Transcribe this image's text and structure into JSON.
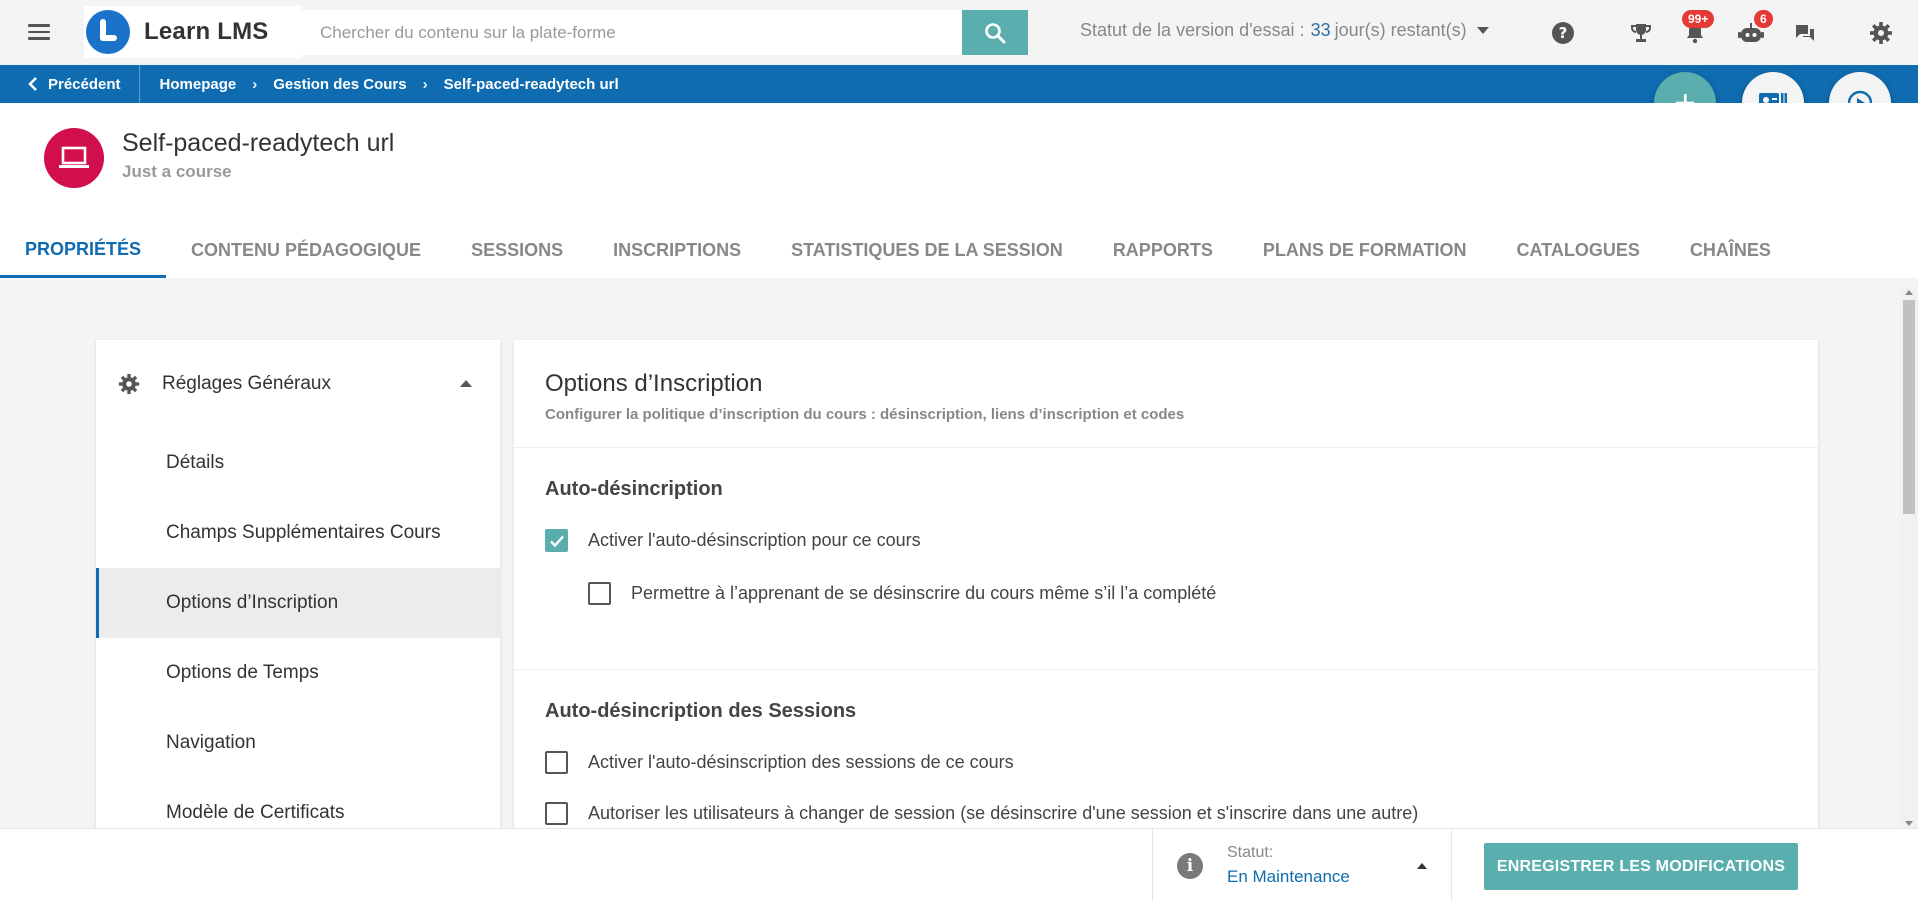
{
  "app": {
    "name": "Learn LMS"
  },
  "search": {
    "placeholder": "Chercher du contenu sur la plate-forme"
  },
  "trial": {
    "prefix": "Statut de la version d'essai :",
    "days": "33",
    "suffix": "jour(s) restant(s)"
  },
  "top_icons": {
    "help": "help-circle-icon",
    "trophy": "trophy-icon",
    "notifications_badge": "99+",
    "robot_badge": "6",
    "chat": "chat-icon",
    "settings": "gear-icon"
  },
  "breadcrumb": {
    "back_label": "Précédent",
    "items": [
      "Homepage",
      "Gestion des Cours",
      "Self-paced-readytech url"
    ]
  },
  "course": {
    "title": "Self-paced-readytech url",
    "subtitle": "Just a course",
    "icon_color": "#d10f4c"
  },
  "tabs": [
    {
      "label": "PROPRIÉTÉS",
      "active": true
    },
    {
      "label": "CONTENU PÉDAGOGIQUE"
    },
    {
      "label": "SESSIONS"
    },
    {
      "label": "INSCRIPTIONS"
    },
    {
      "label": "STATISTIQUES DE LA SESSION"
    },
    {
      "label": "RAPPORTS"
    },
    {
      "label": "PLANS DE FORMATION"
    },
    {
      "label": "CATALOGUES"
    },
    {
      "label": "CHAÎNES"
    }
  ],
  "sidebar": {
    "header": "Réglages Généraux",
    "items": [
      {
        "label": "Détails"
      },
      {
        "label": "Champs Supplémentaires Cours"
      },
      {
        "label": "Options d’Inscription",
        "active": true
      },
      {
        "label": "Options de Temps"
      },
      {
        "label": "Navigation"
      },
      {
        "label": "Modèle de Certificats"
      }
    ]
  },
  "main": {
    "title": "Options d’Inscription",
    "description": "Configurer la politique d’inscription du cours : désinscription, liens d’inscription et codes",
    "groups": [
      {
        "title": "Auto-désincription",
        "options": [
          {
            "label": "Activer l'auto-désinscription pour ce cours",
            "checked": true
          },
          {
            "label": "Permettre à l’apprenant de se désinscrire du cours même s’il l’a complété",
            "checked": false
          }
        ]
      },
      {
        "title": "Auto-désincription des Sessions",
        "options": [
          {
            "label": "Activer l'auto-désinscription des sessions de ce cours",
            "checked": false
          },
          {
            "label": "Autoriser les utilisateurs à changer de session (se désinscrire d'une session et s'inscrire dans une autre)",
            "checked": false
          }
        ]
      }
    ]
  },
  "footer": {
    "status_label": "Statut:",
    "status_value": "En Maintenance",
    "save_label": "ENREGISTRER LES MODIFICATIONS"
  },
  "colors": {
    "brand_blue": "#0f6cb0",
    "accent_teal": "#5aaeae",
    "badge_red": "#e53935"
  }
}
